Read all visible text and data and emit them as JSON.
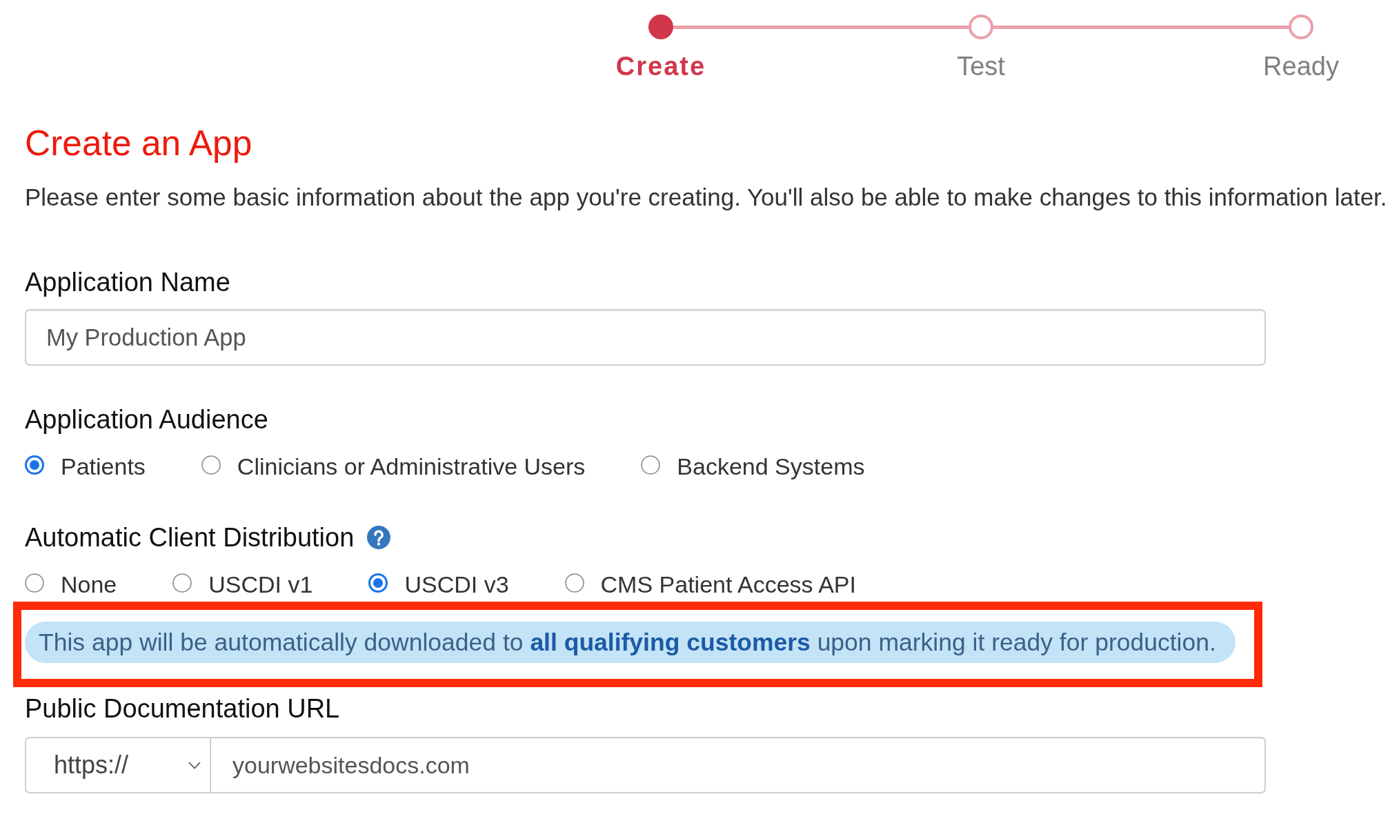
{
  "stepper": {
    "steps": [
      {
        "label": "Create",
        "current": true
      },
      {
        "label": "Test",
        "current": false
      },
      {
        "label": "Ready",
        "current": false
      }
    ]
  },
  "header": {
    "title": "Create an App",
    "intro": "Please enter some basic information about the app you're creating. You'll also be able to make changes to this information later."
  },
  "application_name": {
    "label": "Application Name",
    "value": "My Production App"
  },
  "application_audience": {
    "label": "Application Audience",
    "options": [
      {
        "label": "Patients",
        "selected": true
      },
      {
        "label": "Clinicians or Administrative Users",
        "selected": false
      },
      {
        "label": "Backend Systems",
        "selected": false
      }
    ]
  },
  "automatic_client_distribution": {
    "label": "Automatic Client Distribution",
    "help_icon": true,
    "options": [
      {
        "label": "None",
        "selected": false
      },
      {
        "label": "USCDI v1",
        "selected": false
      },
      {
        "label": "USCDI v3",
        "selected": true
      },
      {
        "label": "CMS Patient Access API",
        "selected": false
      }
    ],
    "notice": {
      "text": "This app will be automatically downloaded to **all qualifying customers** upon marking it ready for production.",
      "highlighted": true
    }
  },
  "public_documentation_url": {
    "label": "Public Documentation URL",
    "protocol": "https://",
    "value": "yourwebsitesdocs.com"
  }
}
